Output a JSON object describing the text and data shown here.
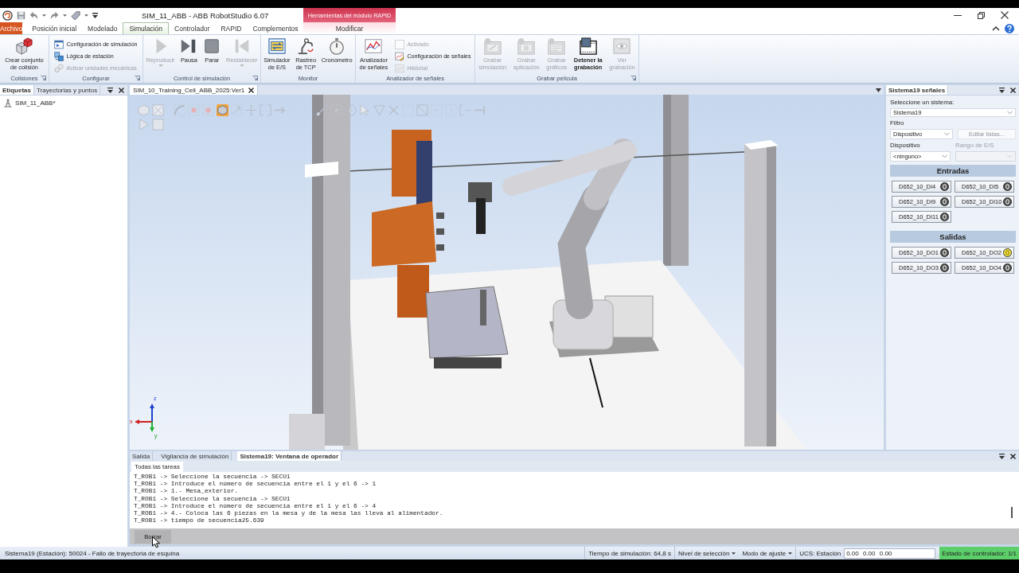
{
  "title_bar": {
    "title": "SIM_11_ABB - ABB RobotStudio 6.07",
    "contextual_header": "Herramientas del módulo RAPID"
  },
  "ribbon_tabs": [
    {
      "label": "Archivo",
      "kind": "file",
      "selected": false
    },
    {
      "label": "Posición inicial",
      "kind": "tab",
      "selected": false
    },
    {
      "label": "Modelado",
      "kind": "tab",
      "selected": false
    },
    {
      "label": "Simulación",
      "kind": "tab",
      "selected": true
    },
    {
      "label": "Controlador",
      "kind": "tab",
      "selected": false
    },
    {
      "label": "RAPID",
      "kind": "tab",
      "selected": false
    },
    {
      "label": "Complementos",
      "kind": "tab",
      "selected": false
    },
    {
      "label": "Modificar",
      "kind": "contextual",
      "selected": false
    }
  ],
  "ribbon_groups": [
    {
      "label": "Colisiones",
      "launcher": true,
      "items": [
        {
          "kind": "large",
          "label": "Crear conjunto\nde colisión",
          "disabled": false,
          "dropdown": false
        }
      ]
    },
    {
      "label": "Configurar",
      "launcher": true,
      "items": [
        {
          "kind": "small",
          "label": "Configuración de simulación",
          "disabled": false
        },
        {
          "kind": "small",
          "label": "Lógica de estación",
          "disabled": false
        },
        {
          "kind": "small",
          "label": "Activar unidades mecánicas",
          "disabled": true
        }
      ]
    },
    {
      "label": "Control de simulación",
      "launcher": true,
      "items": [
        {
          "kind": "large",
          "label": "Reproducir",
          "disabled": true,
          "dropdown": true
        },
        {
          "kind": "large",
          "label": "Pausa",
          "disabled": false,
          "dropdown": false
        },
        {
          "kind": "large",
          "label": "Parar",
          "disabled": false,
          "dropdown": false
        },
        {
          "kind": "large",
          "label": "Restablecer",
          "disabled": true,
          "dropdown": true
        }
      ]
    },
    {
      "label": "Monitor",
      "launcher": false,
      "items": [
        {
          "kind": "large",
          "label": "Simulador\nde E/S",
          "disabled": false,
          "dropdown": false
        },
        {
          "kind": "large",
          "label": "Rastreo\nde TCP",
          "disabled": false,
          "dropdown": false
        },
        {
          "kind": "large",
          "label": "Cronómetro",
          "disabled": false,
          "dropdown": false
        }
      ]
    },
    {
      "label": "Analizador de señales",
      "launcher": false,
      "items": [
        {
          "kind": "large",
          "label": "Analizador\nde señales",
          "disabled": false,
          "dropdown": false
        },
        {
          "kind": "check",
          "label": "Activado",
          "disabled": true,
          "checked": false
        },
        {
          "kind": "small",
          "label": "Configuración de señales",
          "disabled": false
        },
        {
          "kind": "small",
          "label": "Historial",
          "disabled": true
        }
      ]
    },
    {
      "label": "Grabar película",
      "launcher": true,
      "items": [
        {
          "kind": "large",
          "label": "Grabar\nsimulación",
          "disabled": true,
          "dropdown": false,
          "active": false
        },
        {
          "kind": "large",
          "label": "Grabar\naplicación",
          "disabled": true,
          "dropdown": false,
          "active": false
        },
        {
          "kind": "large",
          "label": "Grabar\ngráficos",
          "disabled": true,
          "dropdown": false,
          "active": false
        },
        {
          "kind": "large",
          "label": "Detener la\ngrabación",
          "disabled": false,
          "dropdown": false,
          "active": true
        },
        {
          "kind": "large",
          "label": "Ver\ngrabación",
          "disabled": true,
          "dropdown": false,
          "active": false
        }
      ]
    }
  ],
  "left_panel": {
    "tabs": [
      {
        "label": "Etiquetas",
        "selected": true
      },
      {
        "label": "Trayectorias y puntos",
        "selected": false
      }
    ],
    "tree": [
      {
        "label": "SIM_11_ABB*"
      }
    ]
  },
  "viewport": {
    "tab": "SIM_10_Training_Cell_ABB_2025:Ver1",
    "tools": [
      [
        {
          "selected": false
        },
        {
          "selected": false
        },
        {
          "selected": false
        },
        {
          "selected": false
        },
        {
          "selected": false
        },
        {
          "selected": true
        },
        {
          "selected": false
        },
        {
          "selected": false
        },
        {
          "selected": false
        },
        {
          "selected": false
        },
        {
          "selected": false
        },
        {
          "selected": false
        },
        {
          "selected": false
        },
        {
          "selected": false
        },
        {
          "selected": false
        },
        {
          "selected": false
        },
        {
          "selected": false
        },
        {
          "selected": false
        },
        {
          "selected": false
        },
        {
          "selected": false
        },
        {
          "selected": false
        },
        {
          "selected": false
        }
      ],
      [
        {
          "selected": false
        },
        {
          "selected": false
        }
      ]
    ],
    "axes": [
      "z",
      "x",
      "y"
    ]
  },
  "signals_panel": {
    "tab": "Sistema19 señales",
    "system_label": "Seleccione un sistema:",
    "system": "Sistema19",
    "filter_label": "Filtro",
    "filter": "Dispositivo",
    "edit_button": {
      "label": "Editar listas...",
      "disabled": true
    },
    "device_label": "Dispositivo",
    "device": "<ninguno>",
    "range": {
      "label": "Rango de E/S",
      "disabled": true
    },
    "sections": [
      {
        "title": "Entradas",
        "signals": [
          {
            "name": "D652_10_DI4",
            "on": false
          },
          {
            "name": "D652_10_DI5",
            "on": false
          },
          {
            "name": "D652_10_DI9",
            "on": false
          },
          {
            "name": "D652_10_DI10",
            "on": false
          },
          {
            "name": "D652_10_DI11",
            "on": false
          }
        ]
      },
      {
        "title": "Salidas",
        "signals": [
          {
            "name": "D652_10_DO1",
            "on": false
          },
          {
            "name": "D652_10_DO2",
            "on": true
          },
          {
            "name": "D652_10_DO3",
            "on": false
          },
          {
            "name": "D652_10_DO4",
            "on": false
          }
        ]
      }
    ]
  },
  "output_panel": {
    "tabs": [
      {
        "label": "Salida",
        "selected": false
      },
      {
        "label": "Vigilancia de simulación",
        "selected": false
      },
      {
        "label": "Sistema19: Ventana de operador",
        "selected": true
      }
    ],
    "task_tab": "Todas las tareas",
    "lines": [
      "T_ROB1 -> Seleccione la secuencia -> SECU1",
      "T_ROB1 -> Introduce el número de secuencia entre el 1 y el 6 -> 1",
      "T_ROB1 -> 1.- Mesa_exterior.",
      "T_ROB1 -> Seleccione la secuencia -> SECU1",
      "T_ROB1 -> Introduce el número de secuencia entre el 1 y el 6 -> 4",
      "T_ROB1 -> 4.- Coloca las 6 piezas en la mesa y de la mesa las lleva al alimentador.",
      "T_ROB1 -> tiempo de secuencia25.639"
    ],
    "clear_button": "Borrar"
  },
  "status_bar": {
    "message": "Sistema19 (Estación): 50024 - Fallo de trayectoria de esquina",
    "sim_time": "Tiempo de simulación: 64,8 s",
    "selection_level": "Nivel de selección",
    "snap_mode": "Modo de ajuste",
    "ucs": "UCS: Estación",
    "coordinates": "0.00 0.00 0.00",
    "controller_status": "Estado de controlador: 1/1"
  }
}
